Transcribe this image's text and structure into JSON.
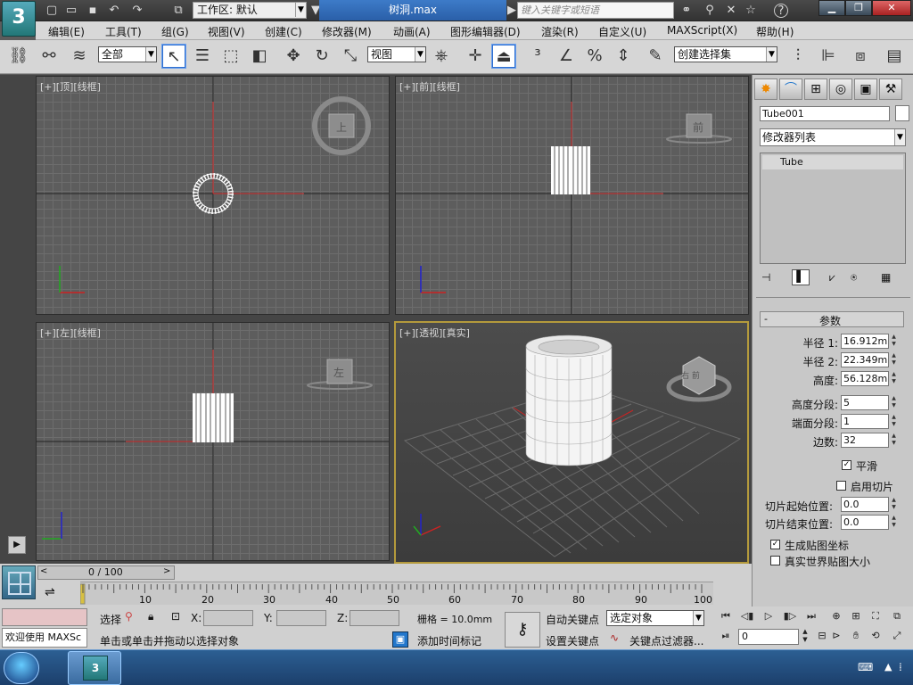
{
  "titlebar": {
    "logo": "3",
    "workspace_label": "工作区: 默认",
    "file_title": "树洞.max",
    "search_placeholder": "键入关键字或短语",
    "icons": [
      "new-icon",
      "open-icon",
      "save-icon",
      "undo-icon",
      "redo-icon",
      "project-icon"
    ],
    "help_icons": [
      "binoculars-icon",
      "search-icon",
      "star-icon",
      "help-icon"
    ]
  },
  "menubar": {
    "items": [
      "编辑(E)",
      "工具(T)",
      "组(G)",
      "视图(V)",
      "创建(C)",
      "修改器(M)",
      "动画(A)",
      "图形编辑器(D)",
      "渲染(R)",
      "自定义(U)",
      "MAXScript(X)",
      "帮助(H)"
    ]
  },
  "toolbar": {
    "selection_filter": "全部",
    "ref_coord": "视图",
    "named_selection": "创建选择集"
  },
  "viewports": [
    {
      "label": "[+][顶][线框]",
      "nav_label": "上"
    },
    {
      "label": "[+][前][线框]",
      "nav_label": "前"
    },
    {
      "label": "[+][左][线框]",
      "nav_label": "左"
    },
    {
      "label": "[+][透视][真实]",
      "nav_label": "右 前"
    }
  ],
  "command_panel": {
    "object_name": "Tube001",
    "modifier_list": "修改器列表",
    "stack_item": "Tube",
    "rollout_title": "参数",
    "params": [
      {
        "label": "半径 1:",
        "value": "16.912mm"
      },
      {
        "label": "半径 2:",
        "value": "22.349mm"
      },
      {
        "label": "高度:",
        "value": "56.128mm"
      },
      {
        "label": "高度分段:",
        "value": "5"
      },
      {
        "label": "端面分段:",
        "value": "1"
      },
      {
        "label": "边数:",
        "value": "32"
      }
    ],
    "smooth": {
      "label": "平滑",
      "checked": true
    },
    "slice_on": {
      "label": "启用切片",
      "checked": false
    },
    "slice_from": {
      "label": "切片起始位置:",
      "value": "0.0"
    },
    "slice_to": {
      "label": "切片结束位置:",
      "value": "0.0"
    },
    "gen_mapping": {
      "label": "生成贴图坐标",
      "checked": true
    },
    "real_world": {
      "label": "真实世界贴图大小",
      "checked": false
    }
  },
  "timeline": {
    "frame": "0 / 100",
    "ticks": [
      "10",
      "20",
      "30",
      "40",
      "50",
      "60",
      "70",
      "80",
      "90",
      "100"
    ]
  },
  "status": {
    "maxscript_line": "欢迎使用 MAXSc",
    "selection_label": "选择",
    "x_label": "X:",
    "y_label": "Y:",
    "z_label": "Z:",
    "grid": "栅格 = 10.0mm",
    "prompt": "单击或单击并拖动以选择对象",
    "add_time_tag": "添加时间标记",
    "auto_key": "自动关键点",
    "set_key": "设置关键点",
    "key_mode": "选定对象",
    "key_filters": "关键点过滤器...",
    "current_frame": "0"
  },
  "colors": {
    "viewport_bg": "#5d5d5d",
    "perspective_bg": "#4a4a4a",
    "active_border": "#b49a3c",
    "panel_bg": "#c8c8c8"
  }
}
